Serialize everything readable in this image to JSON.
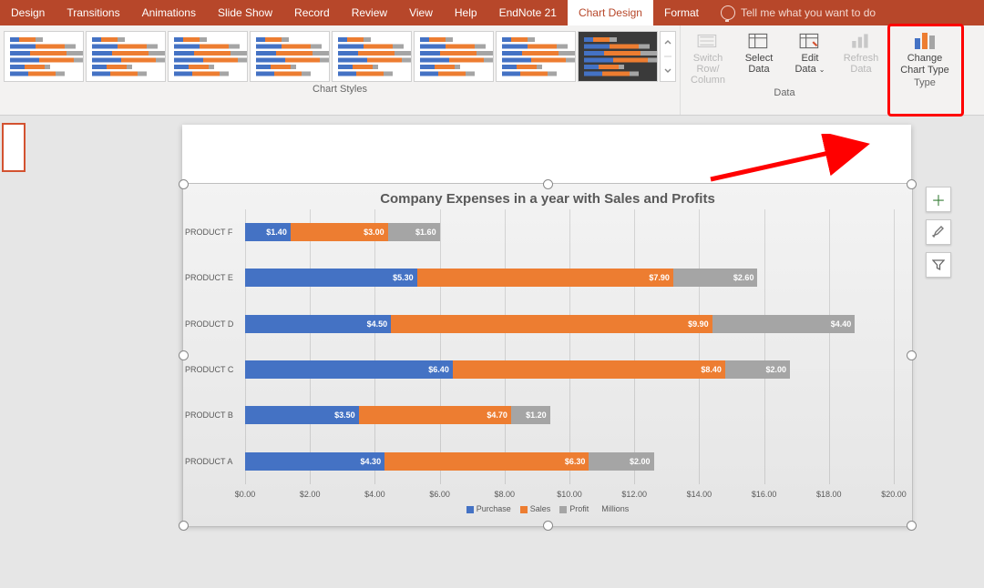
{
  "ribbon_tabs": [
    "Design",
    "Transitions",
    "Animations",
    "Slide Show",
    "Record",
    "Review",
    "View",
    "Help",
    "EndNote 21",
    "Chart Design",
    "Format"
  ],
  "active_tab": "Chart Design",
  "tell_me": "Tell me what you want to do",
  "groups": {
    "styles": "Chart Styles",
    "data": "Data",
    "type": "Type"
  },
  "data_btns": {
    "switch": "Switch Row/\nColumn",
    "select": "Select\nData",
    "edit": "Edit\nData",
    "refresh": "Refresh\nData"
  },
  "type_btn": "Change\nChart Type",
  "chart_data": {
    "type": "bar",
    "title": "Company Expenses in a year with Sales and Profits",
    "categories": [
      "PRODUCT F",
      "PRODUCT E",
      "PRODUCT D",
      "PRODUCT C",
      "PRODUCT B",
      "PRODUCT A"
    ],
    "series": [
      {
        "name": "Purchase",
        "color": "#4472c4",
        "values": [
          1.4,
          5.3,
          4.5,
          6.4,
          3.5,
          4.3
        ]
      },
      {
        "name": "Sales",
        "color": "#ed7d31",
        "values": [
          3.0,
          7.9,
          9.9,
          8.4,
          4.7,
          6.3
        ]
      },
      {
        "name": "Profit",
        "color": "#a5a5a5",
        "values": [
          1.6,
          2.6,
          4.4,
          2.0,
          1.2,
          2.0
        ]
      }
    ],
    "xlim": [
      0,
      20
    ],
    "x_ticks": [
      "$0.00",
      "$2.00",
      "$4.00",
      "$6.00",
      "$8.00",
      "$10.00",
      "$12.00",
      "$14.00",
      "$16.00",
      "$18.00",
      "$20.00"
    ],
    "unit": "Millions"
  }
}
